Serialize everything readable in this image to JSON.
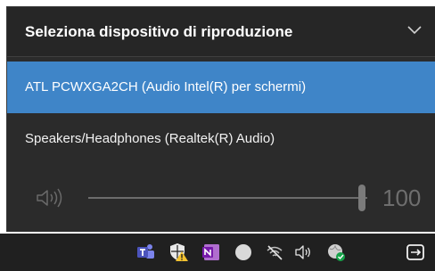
{
  "flyout": {
    "title": "Seleziona dispositivo di riproduzione",
    "devices": [
      {
        "label": "ATL PCWXGA2CH (Audio Intel(R) per schermi)",
        "selected": true
      },
      {
        "label": "Speakers/Headphones (Realtek(R) Audio)",
        "selected": false
      }
    ],
    "volume": {
      "value": "100",
      "level_percent": 100,
      "icon": "speaker-icon"
    }
  },
  "taskbar": {
    "tray_icons": [
      "teams-icon",
      "security-shield-warning-icon",
      "onenote-icon",
      "circle-app-icon",
      "network-offline-icon",
      "speaker-icon",
      "network-ok-icon",
      "display-switch-icon"
    ]
  },
  "colors": {
    "flyout_bg": "#2b2b2b",
    "header_bg": "#262626",
    "selected_bg": "#3f85c8",
    "taskbar_bg": "#202020"
  }
}
